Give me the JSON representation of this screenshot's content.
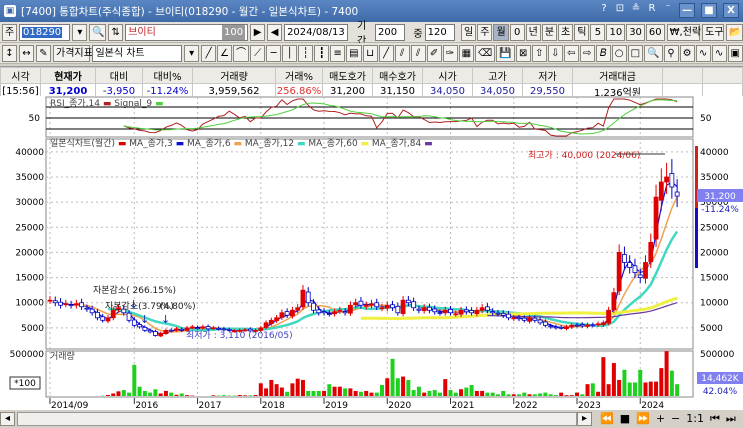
{
  "window": {
    "title": "[7400]  통합차트(주식종합) - 브이티(018290 - 월간 - 일본식차트) - 7400",
    "controls": [
      "?",
      "⊡",
      "≗",
      "R",
      "⁻",
      "—",
      "■",
      "X"
    ]
  },
  "toolbar1": {
    "market": "주",
    "code": "018290",
    "name": "브이티",
    "name_badge": "100",
    "date": "2024/08/13",
    "period_label": "기간",
    "period": "200",
    "count_label": "중",
    "count": "120",
    "intervals": [
      "일",
      "주",
      "월",
      "0",
      "년",
      "분",
      "초",
      "틱",
      "5",
      "10",
      "30",
      "60"
    ],
    "active_interval": "월",
    "won_label": "₩,천락",
    "tools_label": "도구"
  },
  "toolbar2": {
    "indicator_label": "가격지표",
    "chart_type": "일본식 차트",
    "tool_icons": [
      "line",
      "angle",
      "arc",
      "fan",
      "hline",
      "vline",
      "fib",
      "fib2",
      "grid",
      "bars",
      "cycle",
      "ray",
      "channel",
      "parallel",
      "pencil",
      "brush",
      "color",
      "eraser",
      "save",
      "delete",
      "up",
      "down",
      "left",
      "right",
      "text",
      "circle",
      "rect",
      "zoom",
      "magnet",
      "settings",
      "wave",
      "wave2",
      "calc"
    ]
  },
  "quote": {
    "headers": [
      "시각",
      "현재가",
      "대비",
      "대비%",
      "거래량",
      "거래%",
      "매도호가",
      "매수호가",
      "시가",
      "고가",
      "저가",
      "거래대금",
      "",
      ""
    ],
    "values": [
      "[15:56]",
      "31,200",
      "-3,950",
      "-11.24%",
      "3,959,562",
      "256.86%",
      "31,200",
      "31,150",
      "34,050",
      "34,050",
      "29,550",
      "1,236억원",
      "",
      ""
    ],
    "colors": {
      "current": "#0000cc",
      "change": "#0000cc",
      "volume_pct": "#e03030",
      "price": "#2020a0"
    }
  },
  "rsi": {
    "legend": "RSI_종가,14",
    "signal_legend": "Signal_9",
    "axis_label": "50",
    "rsi_color": "#b02020",
    "signal_color": "#50d040"
  },
  "main": {
    "legend_title": "일본식차트(월간)",
    "ma_legends": [
      "MA_종가,3",
      "MA_종가,6",
      "MA_종가,12",
      "MA_종가,60",
      "MA_종가,84"
    ],
    "ma_colors": [
      "#1010d0",
      "#f0a050",
      "#40d8c0",
      "#f0f040",
      "#6a3aa0"
    ],
    "high_annotation": "최고가 : 40,000 (2024/06)",
    "low_annotation": "최저가 : 3,110 (2016/05)",
    "events": [
      "자본감소( 266.15%)",
      "자본감소(3.79%)",
      "(4.80%)"
    ],
    "current_price": "31,200",
    "current_change": "-11.24%"
  },
  "volume": {
    "legend": "거래량",
    "unit": "*100",
    "axis_max": "500000",
    "current": "14,462K",
    "pct": "42.04%"
  },
  "scroll": {
    "ratio": "1:1"
  },
  "chart_data": {
    "type": "candlestick",
    "start": "2014/09",
    "interval": "monthly",
    "x_ticks": [
      "2014/09",
      "2016",
      "2017",
      "2018",
      "2019",
      "2020",
      "2021",
      "2022",
      "2023",
      "2024"
    ],
    "y_ticks": [
      5000,
      10000,
      15000,
      20000,
      25000,
      30000,
      35000,
      40000
    ],
    "ylim": [
      0,
      42000
    ],
    "close": [
      10500,
      10000,
      9500,
      9800,
      9500,
      9800,
      9200,
      8800,
      8000,
      7000,
      6500,
      7000,
      8500,
      9000,
      8000,
      6500,
      5500,
      5200,
      4500,
      4200,
      3500,
      3900,
      4500,
      4400,
      4800,
      4500,
      5000,
      5200,
      5000,
      5200,
      4800,
      5000,
      4800,
      4600,
      4500,
      4400,
      4500,
      4600,
      4400,
      4500,
      5000,
      6000,
      6500,
      7000,
      8000,
      7500,
      8500,
      9000,
      12500,
      10000,
      8500,
      8000,
      8000,
      7800,
      8200,
      8500,
      8000,
      9500,
      10000,
      9500,
      9500,
      9800,
      9200,
      9000,
      9500,
      9000,
      8000,
      10500,
      10000,
      9000,
      8500,
      9000,
      8500,
      8200,
      8000,
      8500,
      8000,
      7800,
      8500,
      8200,
      8000,
      8500,
      9000,
      8500,
      8000,
      7800,
      7500,
      7000,
      7000,
      6800,
      6500,
      7000,
      6500,
      6000,
      5500,
      5200,
      5000,
      5000,
      5200,
      5500,
      5500,
      5400,
      5600,
      5500,
      5800,
      6000,
      8500,
      12000,
      20000,
      18000,
      17000,
      16000,
      15000,
      18000,
      22000,
      31000,
      34000,
      35000,
      33000,
      31200
    ],
    "volume": [
      2000,
      0,
      0,
      0,
      0,
      0,
      0,
      0,
      0,
      0,
      4000,
      12000,
      30000,
      55000,
      70000,
      40000,
      370000,
      110000,
      60000,
      40000,
      80000,
      30000,
      60000,
      40000,
      15000,
      30000,
      10000,
      5000,
      0,
      0,
      0,
      8000,
      5000,
      10000,
      5000,
      5000,
      12000,
      8000,
      8000,
      12000,
      150000,
      90000,
      190000,
      140000,
      100000,
      50000,
      150000,
      205000,
      190000,
      60000,
      60000,
      60000,
      60000,
      140000,
      110000,
      110000,
      90000,
      90000,
      60000,
      50000,
      60000,
      40000,
      40000,
      130000,
      210000,
      440000,
      210000,
      230000,
      190000,
      70000,
      110000,
      40000,
      60000,
      70000,
      40000,
      200000,
      70000,
      40000,
      80000,
      100000,
      130000,
      60000,
      60000,
      40000,
      40000,
      20000,
      60000,
      20000,
      20000,
      20000,
      40000,
      20000,
      20000,
      30000,
      40000,
      20000,
      10000,
      40000,
      10000,
      10000,
      40000,
      20000,
      140000,
      150000,
      50000,
      460000,
      140000,
      390000,
      190000,
      310000,
      160000,
      160000,
      310000,
      160000,
      170000,
      170000,
      330000,
      530000,
      300000,
      140000
    ]
  }
}
